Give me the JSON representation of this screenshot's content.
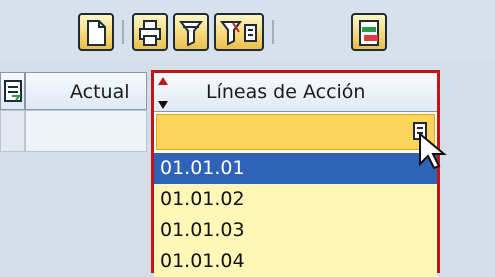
{
  "toolbar": {
    "buttons": [
      {
        "name": "new-document-icon"
      },
      {
        "name": "print-icon"
      },
      {
        "name": "filter-icon"
      },
      {
        "name": "filter-settings-icon"
      },
      {
        "name": "export-icon"
      }
    ]
  },
  "grid": {
    "columns": [
      {
        "label": "Actual"
      },
      {
        "label": "Líneas de Acción"
      }
    ]
  },
  "dropdown": {
    "options": [
      "01.01.01",
      "01.01.02",
      "01.01.03",
      "01.01.04"
    ],
    "selected_index": 0
  },
  "colors": {
    "accent": "#c11616",
    "selected": "#2f63b8",
    "input_bg": "#fcd45b"
  }
}
